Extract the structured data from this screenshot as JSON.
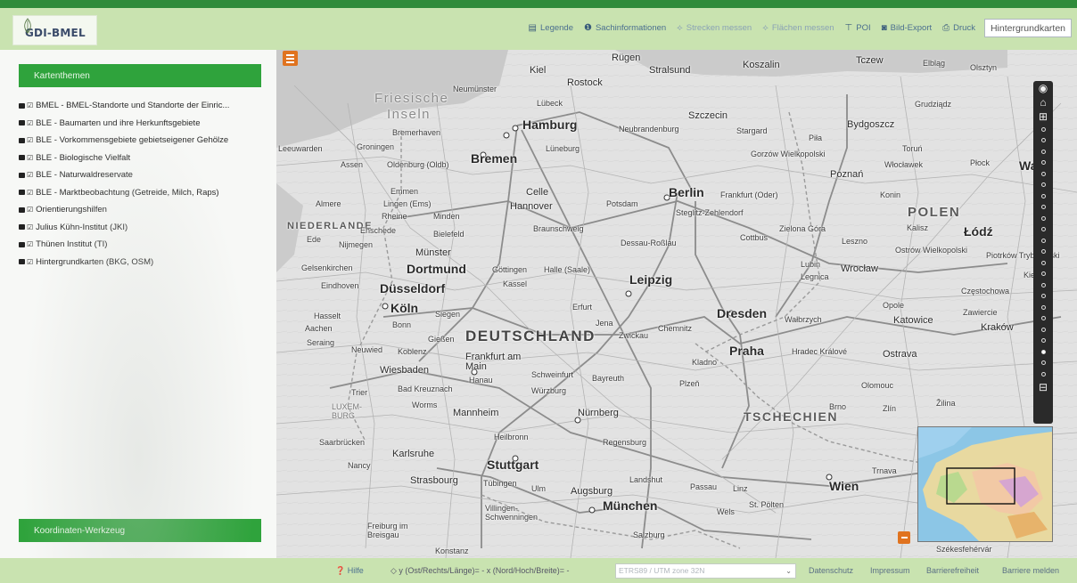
{
  "header": {
    "logo_text": "GDI-BMEL",
    "toolbar": [
      {
        "icon": "book-icon",
        "glyph": "▤",
        "label": "Legende",
        "state": "active"
      },
      {
        "icon": "info-icon",
        "glyph": "❶",
        "label": "Sachinformationen",
        "state": "active"
      },
      {
        "icon": "ruler-icon",
        "glyph": "⟡",
        "label": "Strecken messen",
        "state": "dim"
      },
      {
        "icon": "area-icon",
        "glyph": "⟡",
        "label": "Flächen messen",
        "state": "dim"
      },
      {
        "icon": "pin-icon",
        "glyph": "⊤",
        "label": "POI",
        "state": "active"
      },
      {
        "icon": "camera-icon",
        "glyph": "◙",
        "label": "Bild-Export",
        "state": "active"
      },
      {
        "icon": "printer-icon",
        "glyph": "⎙",
        "label": "Druck",
        "state": "active"
      }
    ],
    "basemap_select": "Hintergrundkarten"
  },
  "left_panel": {
    "themes_header": "Kartenthemen",
    "themes": [
      "BMEL - BMEL-Standorte und Standorte der Einric...",
      "BLE - Baumarten und ihre Herkunftsgebiete",
      "BLE - Vorkommensgebiete gebietseigener Gehölze",
      "BLE - Biologische Vielfalt",
      "BLE - Naturwaldreservate",
      "BLE - Marktbeobachtung (Getreide, Milch, Raps)",
      "Orientierungshilfen",
      "Julius Kühn-Institut (JKI)",
      "Thünen Institut (TI)",
      "Hintergrundkarten (BKG, OSM)"
    ],
    "coord_tool_header": "Koordinaten-Werkzeug"
  },
  "map": {
    "labels": {
      "rugen": "Rügen",
      "kiel": "Kiel",
      "stralsund": "Stralsund",
      "koszalin": "Koszalin",
      "tczew": "Tczew",
      "elblag": "Elbląg",
      "olsztyn": "Olsztyn",
      "rostock": "Rostock",
      "neumunster": "Neumünster",
      "lubeck": "Lübeck",
      "friesische": "Friesische",
      "inseln": "Inseln",
      "grudziadz": "Grudziądz",
      "hamburg": "Hamburg",
      "szczecin": "Szczecin",
      "bremerhaven": "Bremerhaven",
      "neubrandenburg": "Neubrandenburg",
      "stargard": "Stargard",
      "bydgoszcz": "Bydgoszcz",
      "leeuwarden": "Leeuwarden",
      "groningen": "Groningen",
      "luneburg": "Lüneburg",
      "pila": "Piła",
      "torun": "Toruń",
      "bremen": "Bremen",
      "assen": "Assen",
      "oldenburg": "Oldenburg (Oldb)",
      "gorzow": "Gorzów Wielkopolski",
      "wloclawek": "Włocławek",
      "plock": "Płock",
      "warszawa": "Wars",
      "poznan": "Poznań",
      "emmen": "Emmen",
      "celle": "Celle",
      "berlin": "Berlin",
      "frankfurt_oder": "Frankfurt (Oder)",
      "konin": "Konin",
      "almere": "Almere",
      "lingen": "Lingen (Ems)",
      "potsdam": "Potsdam",
      "hannover": "Hannover",
      "minden": "Minden",
      "rheine": "Rheine",
      "steglitz": "Steglitz-Zehlendorf",
      "polen": "POLEN",
      "kalisz": "Kalisz",
      "lodz": "Łódź",
      "niederlande": "NIEDERLANDE",
      "enschede": "Enschede",
      "bielefeld": "Bielefeld",
      "braunschweig": "Braunschweig",
      "zielona": "Zielona Góra",
      "ede": "Ede",
      "nijmegen": "Nijmegen",
      "cottbus": "Cottbus",
      "leszno": "Leszno",
      "ostrow": "Ostrów Wielkopolski",
      "piotrkow": "Piotrków Trybunalski",
      "munster": "Münster",
      "dessau": "Dessau-Roßlau",
      "gelsenkirchen": "Gelsenkirchen",
      "dortmund": "Dortmund",
      "gottingen": "Göttingen",
      "halle": "Halle (Saale)",
      "lubin": "Lubin",
      "wroclaw": "Wrocław",
      "legnica": "Legnica",
      "kielce": "Kielce",
      "eindhoven": "Eindhoven",
      "dusseldorf": "Düsseldorf",
      "kassel": "Kassel",
      "leipzig": "Leipzig",
      "czestochowa": "Częstochowa",
      "opole": "Opole",
      "koln": "Köln",
      "siegen": "Siegen",
      "erfurt": "Erfurt",
      "dresden": "Dresden",
      "walbrzych": "Wałbrzych",
      "zawiercie": "Zawiercie",
      "hasselt": "Hasselt",
      "aachen": "Aachen",
      "bonn": "Bonn",
      "jena": "Jena",
      "zwickau": "Zwickau",
      "chemnitz": "Chemnitz",
      "katowice": "Katowice",
      "krakow": "Kraków",
      "deutschland": "DEUTSCHLAND",
      "giessen": "Gießen",
      "neuwied": "Neuwied",
      "koblenz": "Koblenz",
      "seraing": "Seraing",
      "frankfurt_main": "Frankfurt am Main",
      "hradec": "Hradec Králové",
      "ostrava": "Ostrava",
      "praha": "Praha",
      "kladno": "Kladno",
      "wiesbaden": "Wiesbaden",
      "hanau": "Hanau",
      "schweinfurt": "Schweinfurt",
      "bayreuth": "Bayreuth",
      "plzen": "Plzeň",
      "olomouc": "Olomouc",
      "trier": "Trier",
      "bad_kreuznach": "Bad Kreuznach",
      "wurzburg": "Würzburg",
      "worms": "Worms",
      "luxem": "LUXEM-BURG",
      "mannheim": "Mannheim",
      "nurnberg": "Nürnberg",
      "tschechien": "TSCHECHIEN",
      "brno": "Brno",
      "zlin": "Zlín",
      "zilina": "Žilina",
      "saarbrucken": "Saarbrücken",
      "heilbronn": "Heilbronn",
      "regensburg": "Regensburg",
      "karlsruhe": "Karlsruhe",
      "nancy": "Nancy",
      "stuttgart": "Stuttgart",
      "landshut": "Landshut",
      "trnava": "Trnava",
      "strasbourg": "Strasbourg",
      "tubingen": "Tübingen",
      "ulm": "Ulm",
      "augsburg": "Augsburg",
      "passau": "Passau",
      "linz": "Linz",
      "wien": "Wien",
      "villingen": "Villingen-Schwenningen",
      "munchen": "München",
      "wels": "Wels",
      "st_polten": "St. Pölten",
      "freiburg": "Freiburg im Breisgau",
      "salzburg": "Salzburg",
      "konstanz": "Konstanz",
      "szekesfehervar": "Székesfehérvár"
    }
  },
  "footer": {
    "help": "Hilfe",
    "coords": "◇ y (Ost/Rechts/Länge)= - x (Nord/Hoch/Breite)= -",
    "crs_select": "ETRS89 / UTM zone 32N",
    "links": [
      "Datenschutz",
      "Impressum",
      "Barrierefreiheit",
      "Barriere melden"
    ]
  }
}
